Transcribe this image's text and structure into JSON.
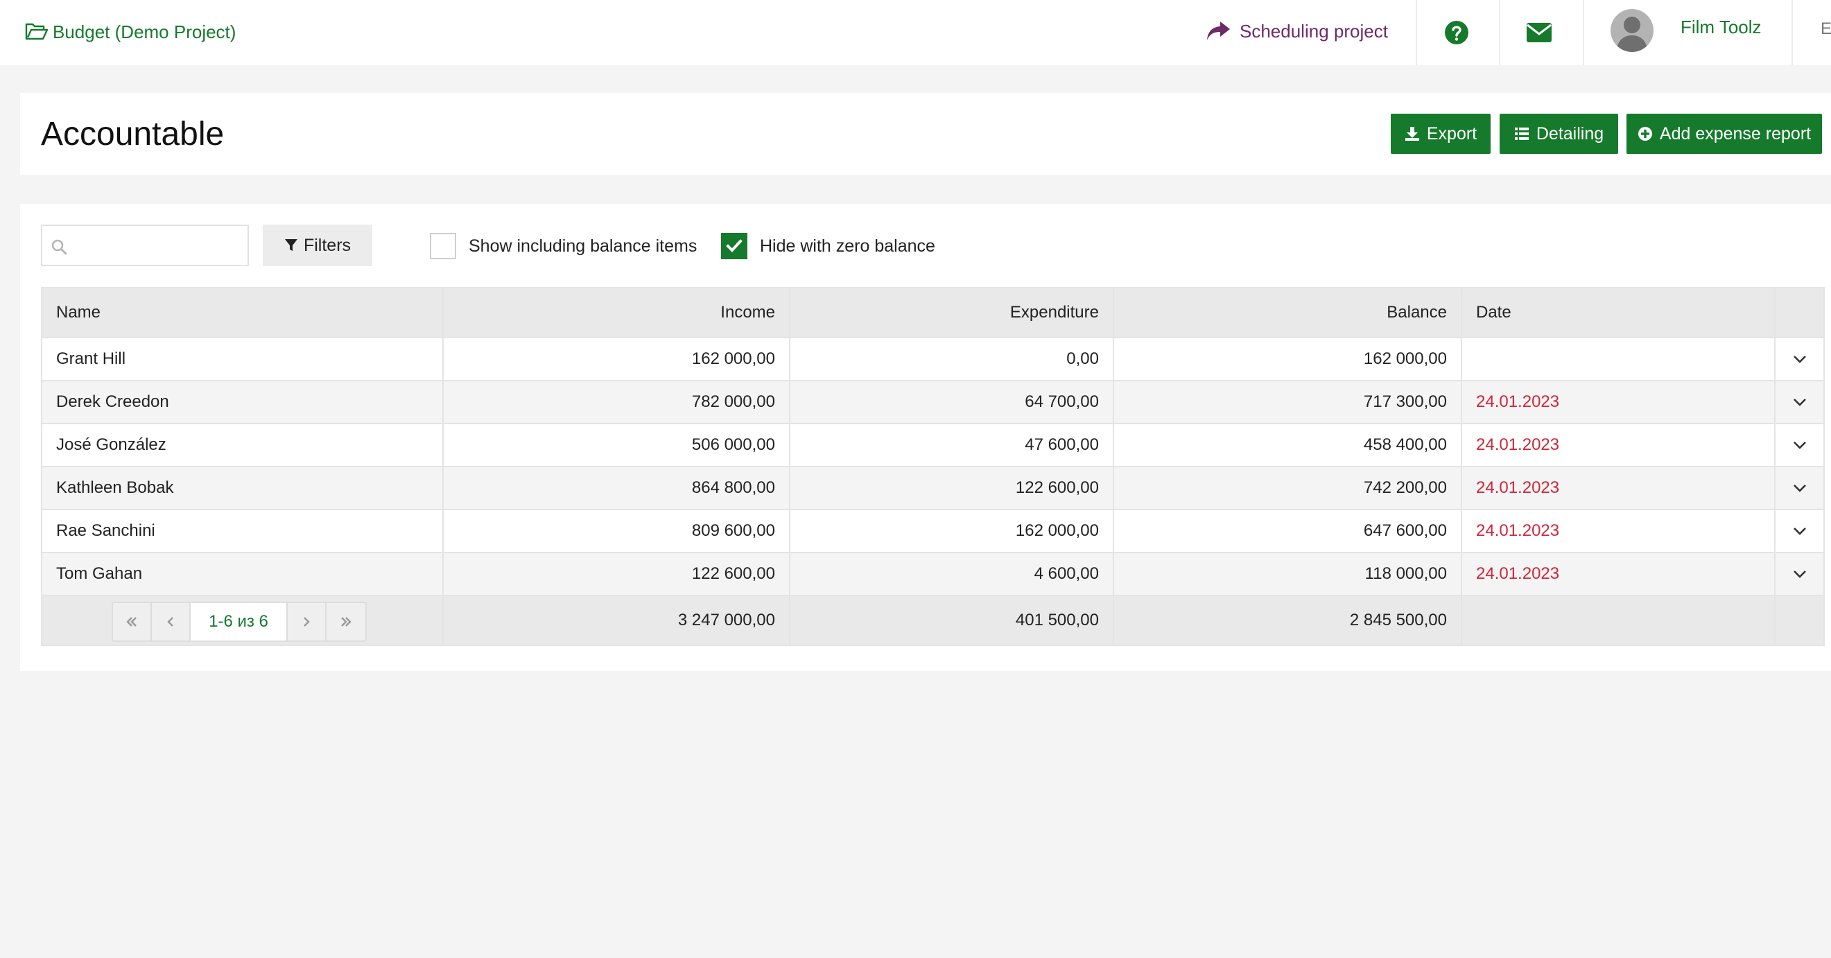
{
  "header": {
    "project_label": "Budget (Demo Project)",
    "scheduling_label": "Scheduling project",
    "user_name": "Film Toolz",
    "truncated_text": "E",
    "icons": [
      "folder-open-icon",
      "share-arrow-icon",
      "help-circle-icon",
      "envelope-icon",
      "user-avatar"
    ]
  },
  "page": {
    "title": "Accountable",
    "buttons": {
      "export": "Export",
      "detailing": "Detailing",
      "add_report": "Add expense report"
    }
  },
  "toolbar": {
    "search_placeholder": "",
    "filters_label": "Filters",
    "show_balance_label": "Show including balance items",
    "show_balance_checked": false,
    "hide_zero_label": "Hide with zero balance",
    "hide_zero_checked": true
  },
  "table": {
    "columns": [
      "Name",
      "Income",
      "Expenditure",
      "Balance",
      "Date"
    ],
    "rows": [
      {
        "name": "Grant Hill",
        "income": "162 000,00",
        "expenditure": "0,00",
        "balance": "162 000,00",
        "date": ""
      },
      {
        "name": "Derek Creedon",
        "income": "782 000,00",
        "expenditure": "64 700,00",
        "balance": "717 300,00",
        "date": "24.01.2023"
      },
      {
        "name": "José González",
        "income": "506 000,00",
        "expenditure": "47 600,00",
        "balance": "458 400,00",
        "date": "24.01.2023"
      },
      {
        "name": "Kathleen Bobak",
        "income": "864 800,00",
        "expenditure": "122 600,00",
        "balance": "742 200,00",
        "date": "24.01.2023"
      },
      {
        "name": "Rae Sanchini",
        "income": "809 600,00",
        "expenditure": "162 000,00",
        "balance": "647 600,00",
        "date": "24.01.2023"
      },
      {
        "name": "Tom Gahan",
        "income": "122 600,00",
        "expenditure": "4 600,00",
        "balance": "118 000,00",
        "date": "24.01.2023"
      }
    ],
    "totals": {
      "income": "3 247 000,00",
      "expenditure": "401 500,00",
      "balance": "2 845 500,00"
    },
    "pager_info": "1-6 из 6"
  },
  "colors": {
    "brand_green": "#157a2b",
    "scheduling_purple": "#6d2a69",
    "date_red": "#d1263a"
  }
}
